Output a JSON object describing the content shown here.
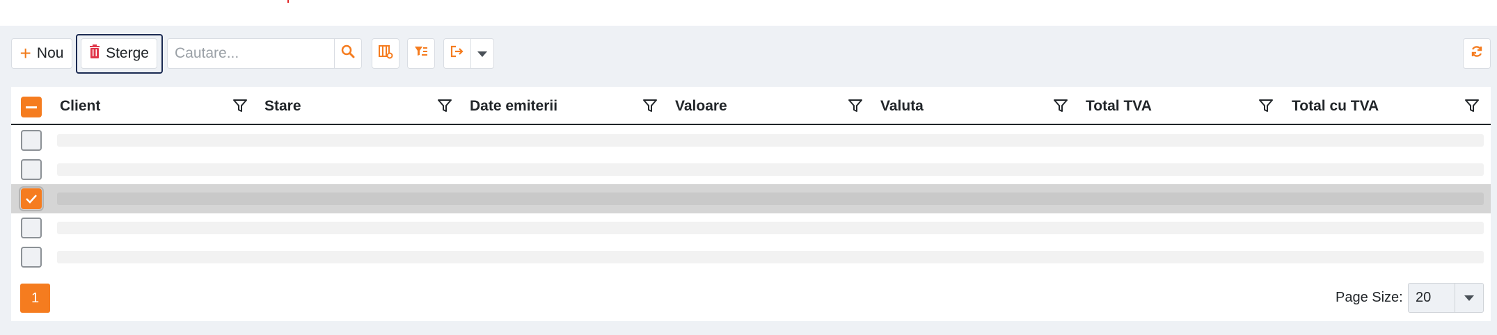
{
  "toolbar": {
    "new_label": "Nou",
    "delete_label": "Sterge",
    "search_placeholder": "Cautare..."
  },
  "grid": {
    "columns": [
      "Client",
      "Stare",
      "Date emiterii",
      "Valoare",
      "Valuta",
      "Total TVA",
      "Total cu TVA"
    ],
    "row_selected": [
      false,
      false,
      true,
      false,
      false
    ]
  },
  "pager": {
    "current_page": "1",
    "page_size_label": "Page Size:",
    "page_size_value": "20"
  },
  "colors": {
    "accent": "#f57c1f",
    "delete_icon": "#e0364a",
    "panel_bg": "#eef1f5"
  },
  "icons": {
    "new": "plus-icon",
    "delete": "trash-icon",
    "search": "search-icon",
    "columns": "column-chooser-icon",
    "filter": "filter-builder-icon",
    "export": "export-icon",
    "caret": "chevron-down-icon",
    "refresh": "refresh-icon",
    "column_filter": "funnel-icon"
  }
}
